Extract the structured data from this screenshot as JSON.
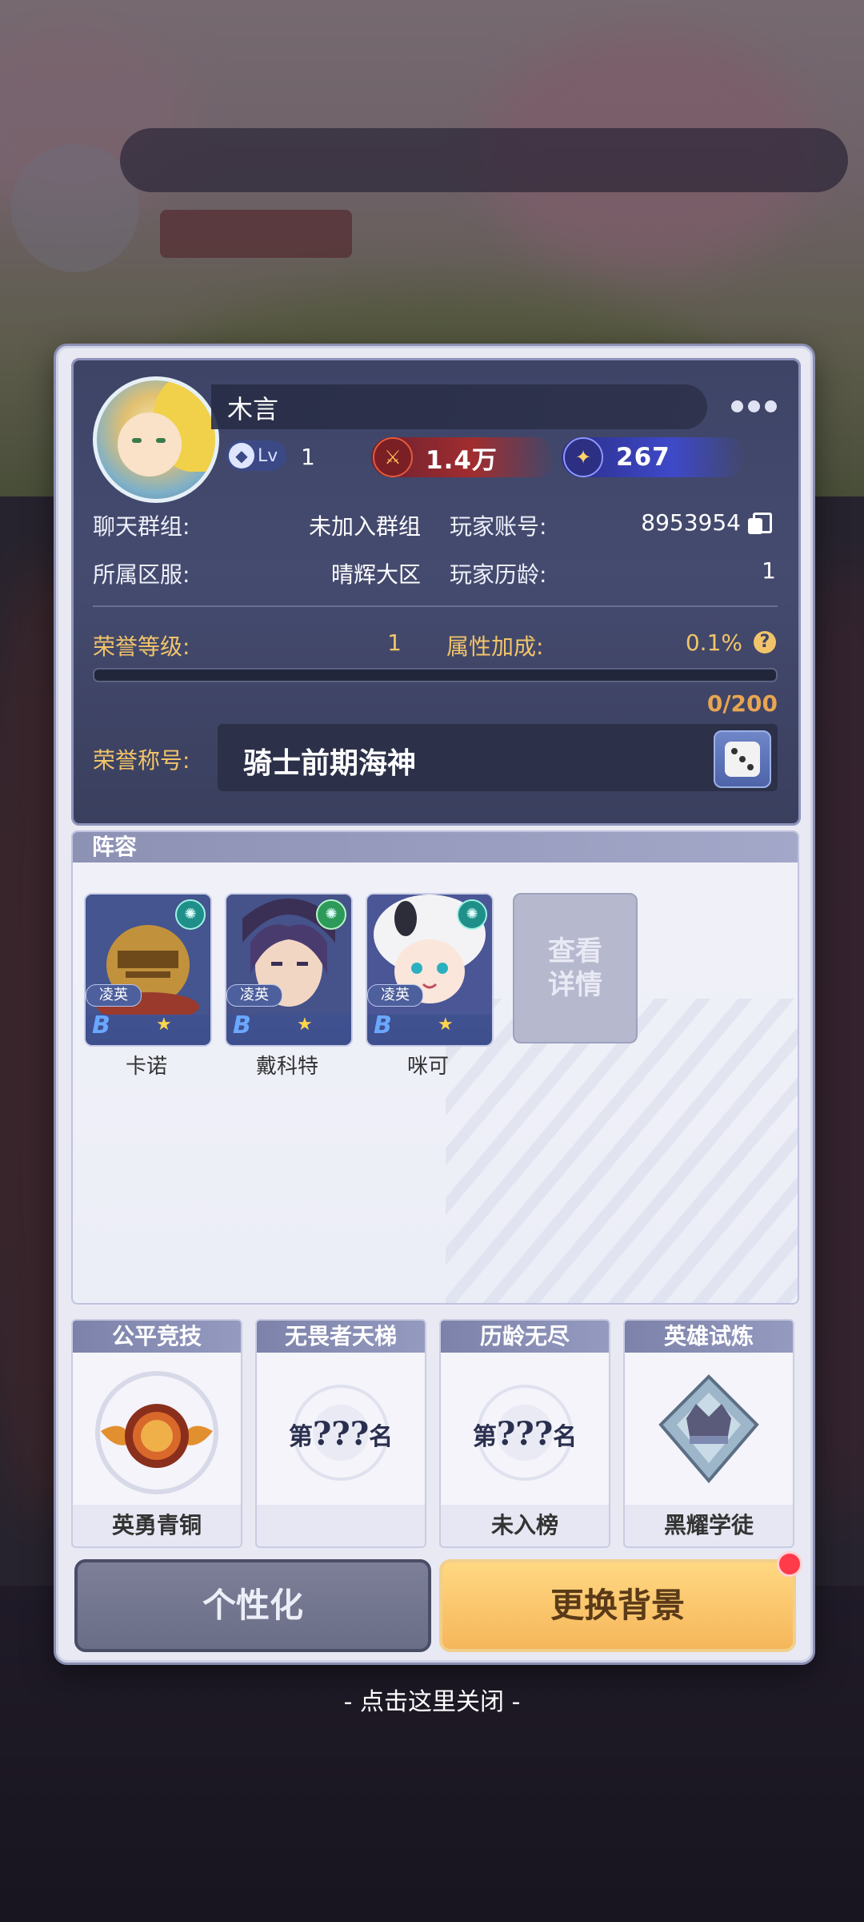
{
  "profile": {
    "name": "木言",
    "level_label": "Lv",
    "level": "1",
    "power": "1.4万",
    "stars": "267",
    "chat_group_label": "聊天群组:",
    "chat_group_value": "未加入群组",
    "account_label": "玩家账号:",
    "account_value": "8953954",
    "server_label": "所属区服:",
    "server_value": "晴辉大区",
    "age_label": "玩家历龄:",
    "age_value": "1",
    "honor_level_label": "荣誉等级:",
    "honor_level_value": "1",
    "attr_bonus_label": "属性加成:",
    "attr_bonus_value": "0.1%",
    "help_icon": "?",
    "exp_text": "0/200",
    "exp_fraction": 0,
    "honor_title_label": "荣誉称号:",
    "honor_title_value": "骑士前期海神"
  },
  "lineup": {
    "header": "阵容",
    "heroes": [
      {
        "name": "卡诺",
        "tag": "凌英",
        "rank": "B",
        "star": "★"
      },
      {
        "name": "戴科特",
        "tag": "凌英",
        "rank": "B",
        "star": "★"
      },
      {
        "name": "咪可",
        "tag": "凌英",
        "rank": "B",
        "star": "★"
      }
    ],
    "detail_button": "查看详情"
  },
  "rankings": [
    {
      "title": "公平竞技",
      "footer": "英勇青铜"
    },
    {
      "title": "无畏者天梯",
      "prefix": "第",
      "placeholder": "???",
      "suffix": "名",
      "footer": ""
    },
    {
      "title": "历龄无尽",
      "prefix": "第",
      "placeholder": "???",
      "suffix": "名",
      "footer": "未入榜"
    },
    {
      "title": "英雄试炼",
      "footer": "黑耀学徒"
    }
  ],
  "buttons": {
    "personalize": "个性化",
    "change_background": "更换背景"
  },
  "close_hint": "- 点击这里关闭 -"
}
